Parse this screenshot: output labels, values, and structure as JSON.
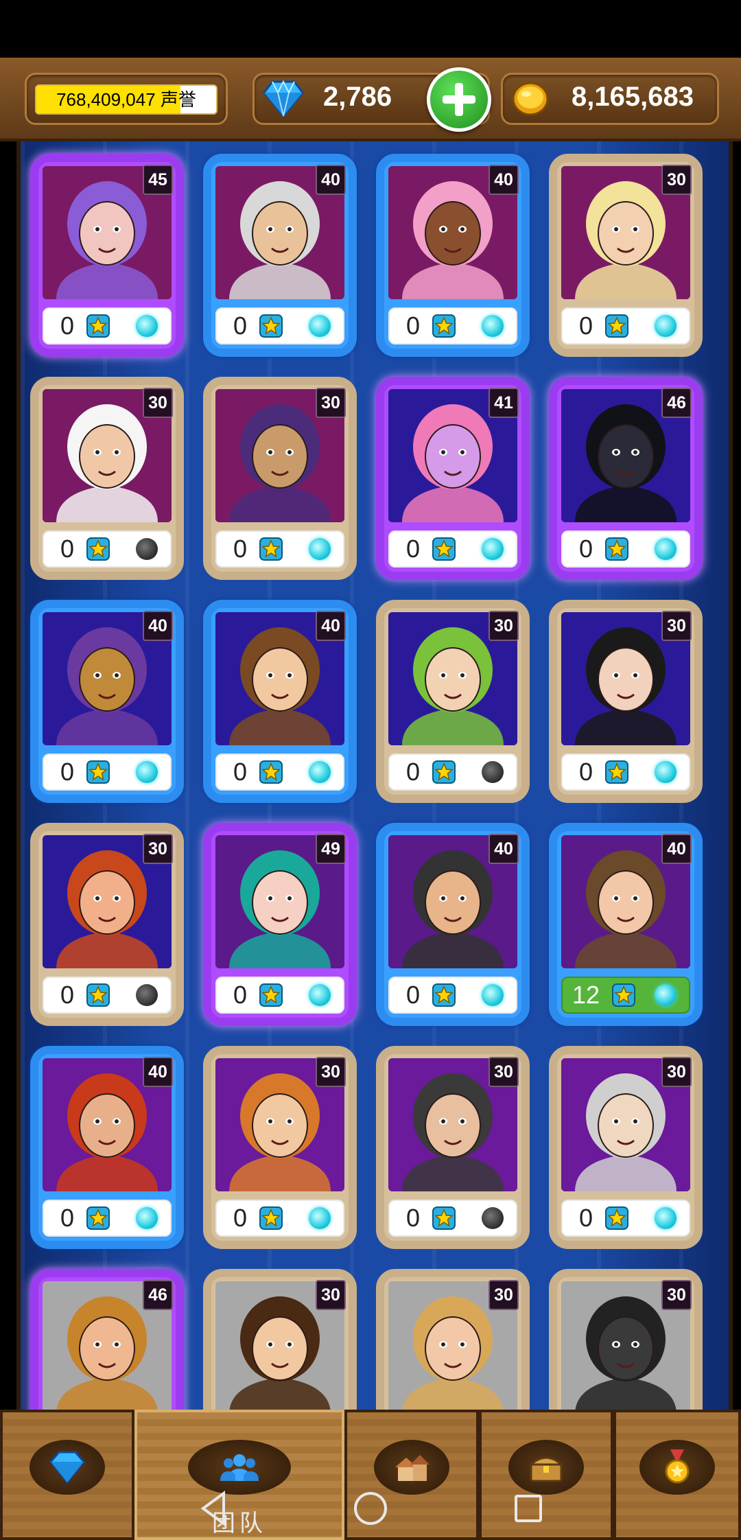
{
  "header": {
    "renown_value": "768,409,047",
    "renown_label": "声誉",
    "renown_progress": 0.8,
    "gems": "2,786",
    "gold": "8,165,683"
  },
  "heroes": [
    {
      "level": "45",
      "stars": "0",
      "frame": "purple",
      "status": "on",
      "bg": "#7a1a64",
      "skin": "#f2c6c0",
      "hair": "#8a5cd6"
    },
    {
      "level": "40",
      "stars": "0",
      "frame": "blue",
      "status": "on",
      "bg": "#7a1a64",
      "skin": "#e9c29a",
      "hair": "#d8d8d8"
    },
    {
      "level": "40",
      "stars": "0",
      "frame": "blue",
      "status": "on",
      "bg": "#7a1a64",
      "skin": "#8a4f2f",
      "hair": "#f2a0c8"
    },
    {
      "level": "30",
      "stars": "0",
      "frame": "tan",
      "status": "on",
      "bg": "#7a1a64",
      "skin": "#f2d0b0",
      "hair": "#f2e29a"
    },
    {
      "level": "30",
      "stars": "0",
      "frame": "tan",
      "status": "off",
      "bg": "#7a1a64",
      "skin": "#f0c8a8",
      "hair": "#f5f5f5"
    },
    {
      "level": "30",
      "stars": "0",
      "frame": "tan",
      "status": "on",
      "bg": "#7a1a64",
      "skin": "#c99b6b",
      "hair": "#4a2c7a"
    },
    {
      "level": "41",
      "stars": "0",
      "frame": "purple",
      "status": "on",
      "bg": "#2a1a9a",
      "skin": "#d59be8",
      "hair": "#f07ab8"
    },
    {
      "level": "46",
      "stars": "0",
      "frame": "purple",
      "status": "on",
      "bg": "#2a1a9a",
      "skin": "#2a2a38",
      "hair": "#111118"
    },
    {
      "level": "40",
      "stars": "0",
      "frame": "blue",
      "status": "on",
      "bg": "#2a1a9a",
      "skin": "#c08a3a",
      "hair": "#6a3aa0"
    },
    {
      "level": "40",
      "stars": "0",
      "frame": "blue",
      "status": "on",
      "bg": "#2a1a9a",
      "skin": "#f2c8a0",
      "hair": "#7a4a22"
    },
    {
      "level": "30",
      "stars": "0",
      "frame": "tan",
      "status": "off",
      "bg": "#2a1a9a",
      "skin": "#f2d2b2",
      "hair": "#79c23a"
    },
    {
      "level": "30",
      "stars": "0",
      "frame": "tan",
      "status": "on",
      "bg": "#2a1a9a",
      "skin": "#f2d2bc",
      "hair": "#1a1a1a"
    },
    {
      "level": "30",
      "stars": "0",
      "frame": "tan",
      "status": "off",
      "bg": "#2a1a9a",
      "skin": "#f2b08a",
      "hair": "#c8481c"
    },
    {
      "level": "49",
      "stars": "0",
      "frame": "purple",
      "status": "on",
      "bg": "#5a1a8a",
      "skin": "#f6d0c2",
      "hair": "#1aa89a"
    },
    {
      "level": "40",
      "stars": "0",
      "frame": "blue",
      "status": "on",
      "bg": "#5a1a8a",
      "skin": "#e8b48a",
      "hair": "#333333"
    },
    {
      "level": "40",
      "stars": "12",
      "frame": "blue",
      "status": "on",
      "bg": "#5a1a8a",
      "skin": "#f2c8a8",
      "hair": "#6a4a2a",
      "bar": "green"
    },
    {
      "level": "40",
      "stars": "0",
      "frame": "blue",
      "status": "on",
      "bg": "#6a1a9a",
      "skin": "#e8b08a",
      "hair": "#c83a1a"
    },
    {
      "level": "30",
      "stars": "0",
      "frame": "tan",
      "status": "on",
      "bg": "#6a1a9a",
      "skin": "#f2c8a0",
      "hair": "#d8782a"
    },
    {
      "level": "30",
      "stars": "0",
      "frame": "tan",
      "status": "off",
      "bg": "#6a1a9a",
      "skin": "#e8c0a0",
      "hair": "#3a3a3a"
    },
    {
      "level": "30",
      "stars": "0",
      "frame": "tan",
      "status": "on",
      "bg": "#6a1a9a",
      "skin": "#f0d8c0",
      "hair": "#cfcfcf"
    },
    {
      "level": "46",
      "stars": "0",
      "frame": "purple",
      "status": "on",
      "bg": "#a8a8a8",
      "skin": "#f0b890",
      "hair": "#c8842a"
    },
    {
      "level": "30",
      "stars": "0",
      "frame": "tan",
      "status": "on",
      "bg": "#a8a8a8",
      "skin": "#f2c8a0",
      "hair": "#4a2a12"
    },
    {
      "level": "30",
      "stars": "0",
      "frame": "tan",
      "status": "on",
      "bg": "#a8a8a8",
      "skin": "#f2c8a8",
      "hair": "#d8a858"
    },
    {
      "level": "30",
      "stars": "0",
      "frame": "tan",
      "status": "on",
      "bg": "#a8a8a8",
      "skin": "#3a3a3a",
      "hair": "#222222"
    }
  ],
  "nav": {
    "tabs": [
      {
        "icon": "diamond-icon"
      },
      {
        "icon": "team-icon",
        "label": "团队",
        "active": true
      },
      {
        "icon": "buildings-icon"
      },
      {
        "icon": "treasure-chest-icon"
      },
      {
        "icon": "medal-icon"
      }
    ]
  }
}
